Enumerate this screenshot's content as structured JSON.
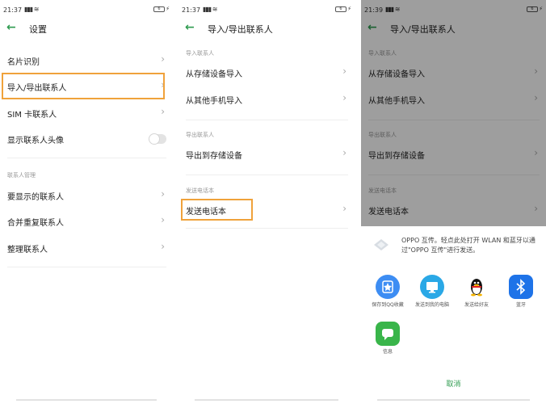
{
  "screen1": {
    "time": "21:37",
    "title": "设置",
    "rows": [
      {
        "label": "名片识别"
      },
      {
        "label": "导入/导出联系人"
      },
      {
        "label": "SIM 卡联系人"
      },
      {
        "label": "显示联系人头像"
      }
    ],
    "section": "联系人管理",
    "rows2": [
      {
        "label": "要显示的联系人"
      },
      {
        "label": "合并重复联系人"
      },
      {
        "label": "整理联系人"
      }
    ]
  },
  "screen2": {
    "time": "21:37",
    "title": "导入/导出联系人",
    "section_import": "导入联系人",
    "import_rows": [
      {
        "label": "从存储设备导入"
      },
      {
        "label": "从其他手机导入"
      }
    ],
    "section_export": "导出联系人",
    "export_rows": [
      {
        "label": "导出到存储设备"
      }
    ],
    "section_send": "发送电话本",
    "send_rows": [
      {
        "label": "发送电话本"
      }
    ]
  },
  "screen3": {
    "time": "21:39",
    "title": "导入/导出联系人",
    "section_import": "导入联系人",
    "import_rows": [
      {
        "label": "从存储设备导入"
      },
      {
        "label": "从其他手机导入"
      }
    ],
    "section_export": "导出联系人",
    "export_rows": [
      {
        "label": "导出到存储设备"
      }
    ],
    "section_send": "发送电话本",
    "send_rows": [
      {
        "label": "发送电话本"
      }
    ],
    "sheet": {
      "oppo_text": "OPPO 互传。轻点此处打开 WLAN 和蓝牙以通过\"OPPO 互传\"进行发送。",
      "targets": [
        {
          "label": "保存到QQ收藏",
          "icon": "qq-favorites-icon",
          "color": "#3d8df3"
        },
        {
          "label": "发送到我的电脑",
          "icon": "my-computer-icon",
          "color": "#2aa8e6"
        },
        {
          "label": "发送给好友",
          "icon": "qq-penguin-icon",
          "color": "#ffffff"
        },
        {
          "label": "蓝牙",
          "icon": "bluetooth-icon",
          "color": "#1e73e8"
        },
        {
          "label": "信息",
          "icon": "message-icon",
          "color": "#39b54a"
        }
      ],
      "cancel": "取消"
    }
  },
  "accent_color": "#2e9b4f",
  "highlight_color": "#f0a23b"
}
